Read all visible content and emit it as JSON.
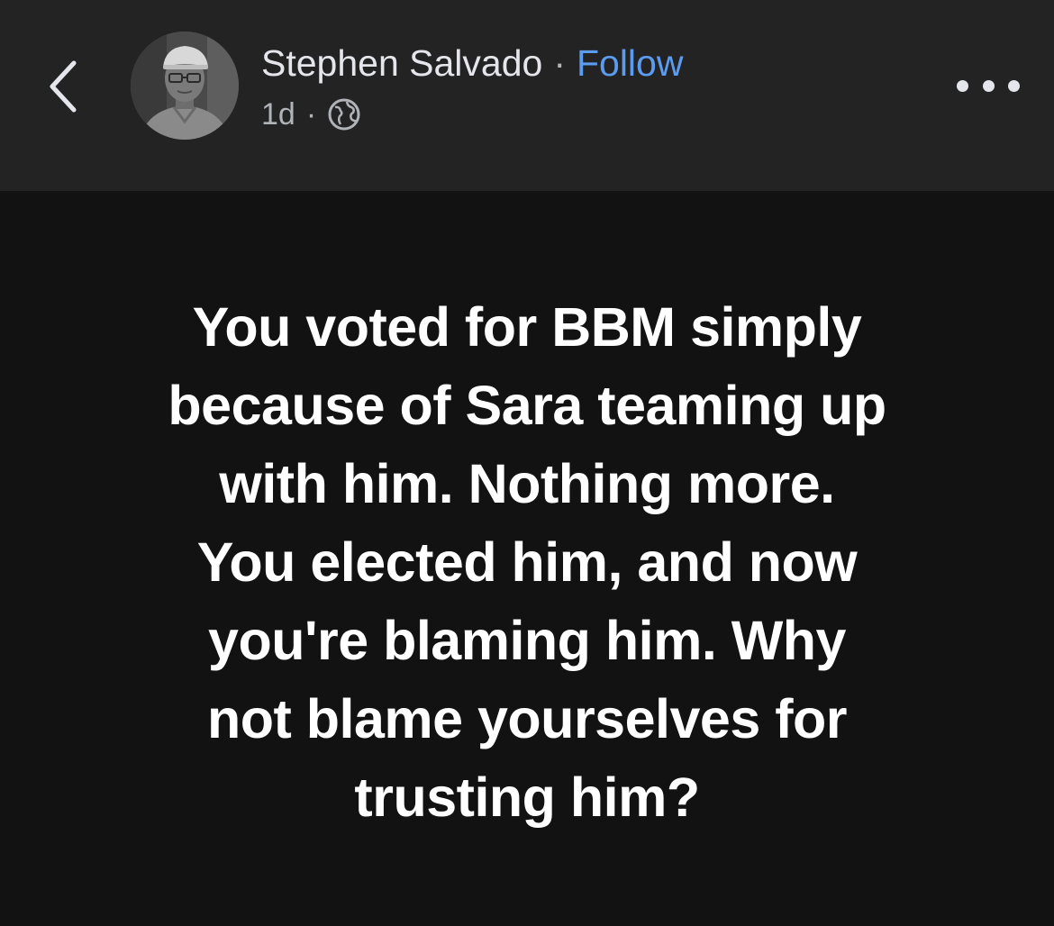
{
  "header": {
    "author_name": "Stephen Salvado",
    "separator": "·",
    "follow_label": "Follow",
    "timestamp": "1d",
    "meta_separator": "·",
    "privacy_icon": "globe-icon",
    "back_icon": "chevron-left-icon",
    "more_icon": "more-horizontal-icon"
  },
  "post": {
    "lines": [
      "You voted for BBM simply",
      "because of Sara teaming up",
      "with him. Nothing more.",
      "You elected him, and now",
      "you're blaming him. Why",
      "not blame yourselves for",
      "trusting him?"
    ]
  },
  "colors": {
    "header_bg": "#232323",
    "body_bg": "#121212",
    "follow_link": "#5b9bf0",
    "meta_text": "#b0b3b8"
  }
}
